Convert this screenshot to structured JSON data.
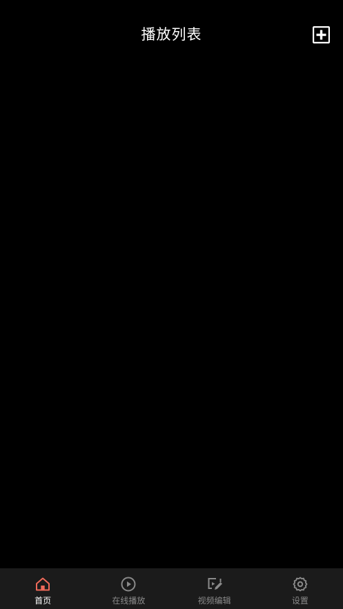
{
  "header": {
    "title": "播放列表",
    "add_icon": "plus-square-icon"
  },
  "tabs": [
    {
      "label": "首页",
      "icon": "home-icon",
      "active": true
    },
    {
      "label": "在线播放",
      "icon": "play-circle-icon",
      "active": false
    },
    {
      "label": "视频编辑",
      "icon": "edit-video-icon",
      "active": false
    },
    {
      "label": "设置",
      "icon": "gear-icon",
      "active": false
    }
  ],
  "colors": {
    "background": "#000000",
    "tabbar": "#1b1b1b",
    "accent": "#f06a5a",
    "inactive": "#8a8a8a",
    "text": "#ffffff"
  }
}
